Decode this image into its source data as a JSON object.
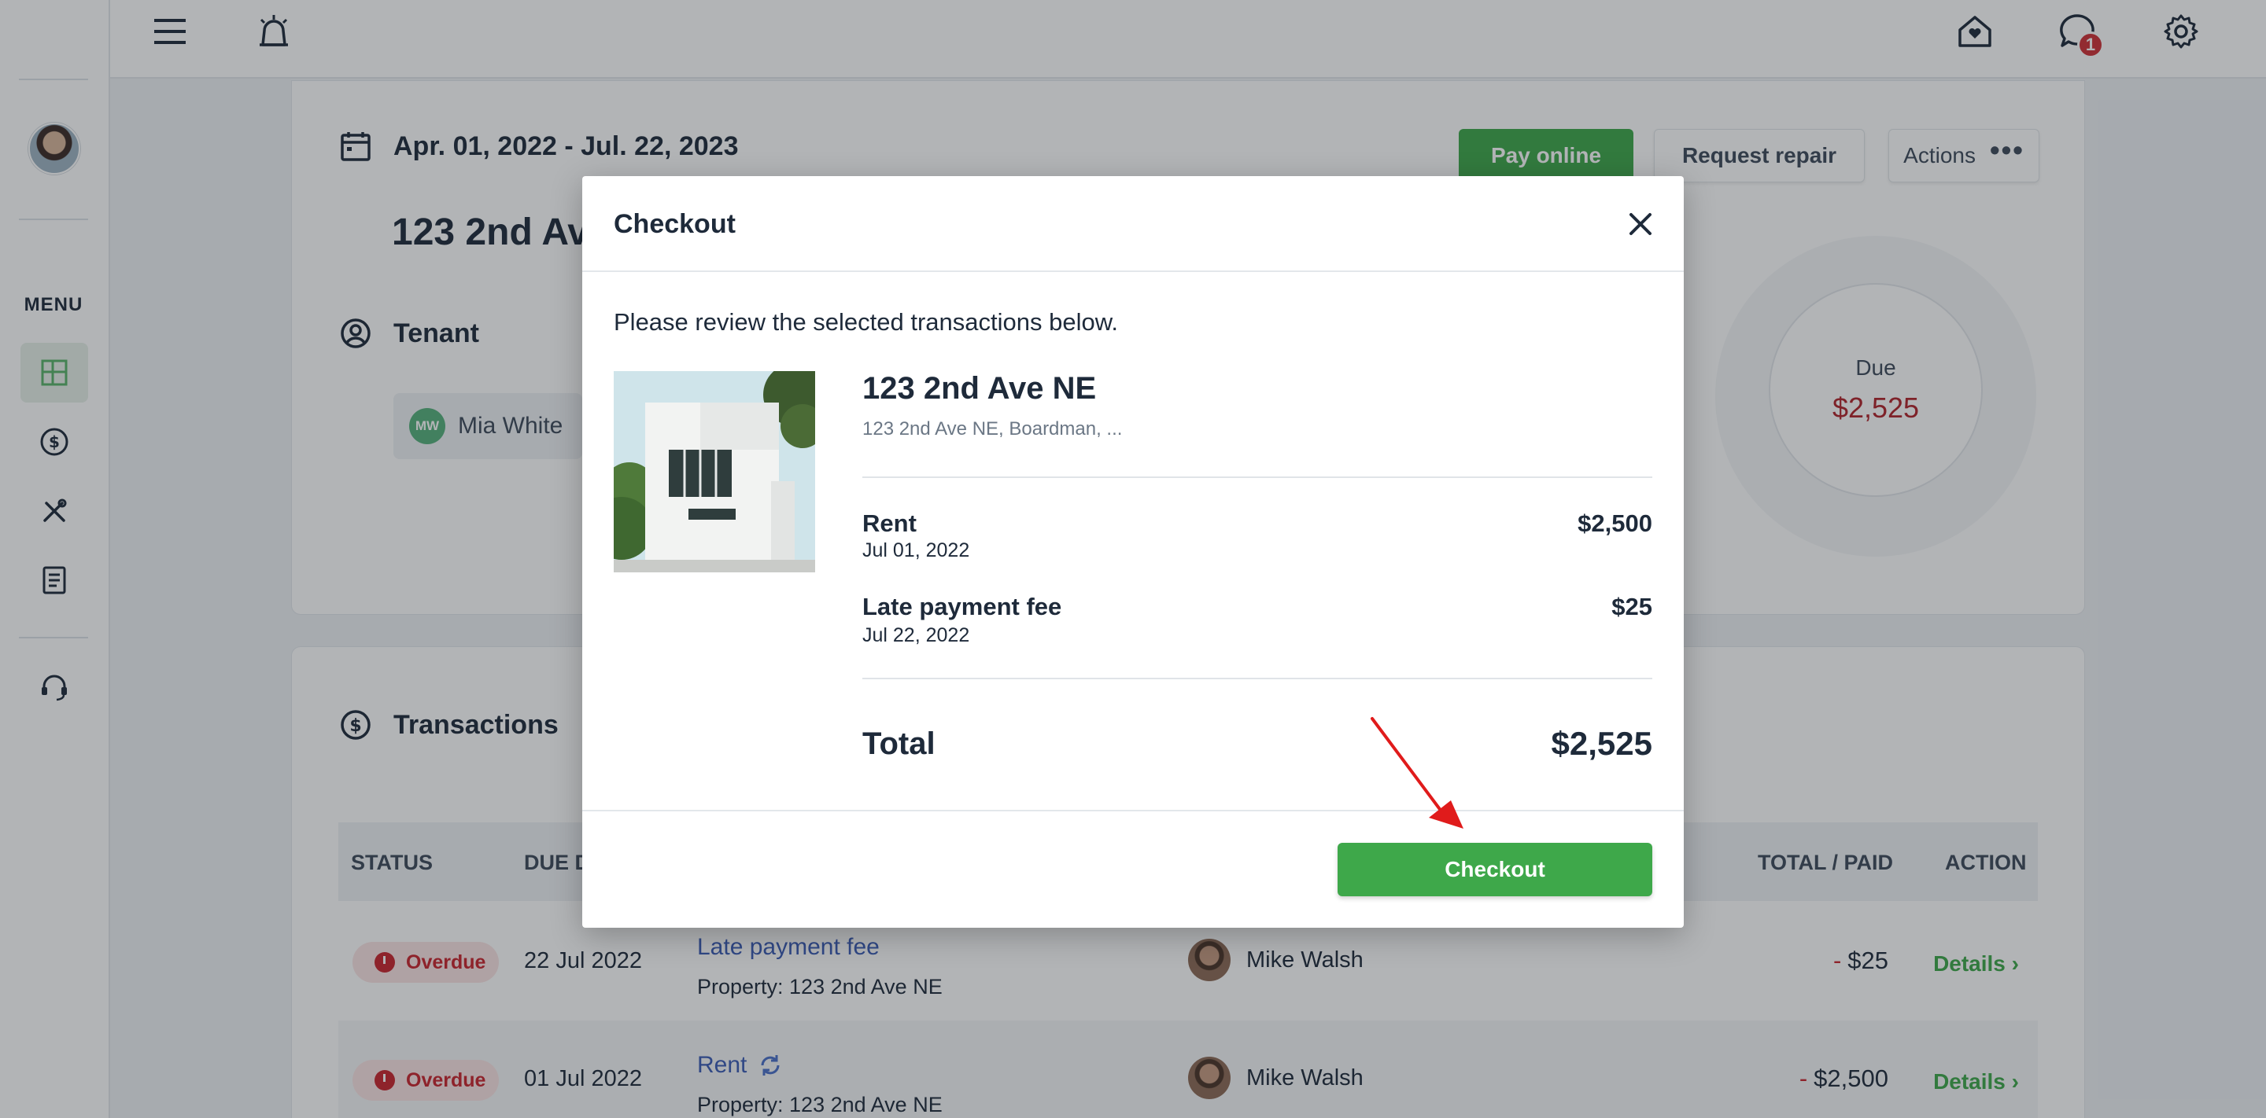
{
  "sidebar": {
    "menu_label": "MENU",
    "items": [
      {
        "icon": "dashboard-icon",
        "active": true
      },
      {
        "icon": "dollar-circle-icon"
      },
      {
        "icon": "tools-icon"
      },
      {
        "icon": "document-icon"
      },
      {
        "icon": "headset-icon"
      }
    ]
  },
  "topbar": {
    "left_icons": [
      "hamburger-menu-icon",
      "alarm-icon"
    ],
    "right_icons": [
      "home-heart-icon",
      "chat-icon",
      "gear-icon"
    ],
    "notification_count": "1"
  },
  "lease": {
    "date_range": "Apr. 01, 2022 - Jul. 22, 2023",
    "property_title": "123 2nd Av",
    "tenant_section_title": "Tenant",
    "tenant": {
      "initials": "MW",
      "name": "Mia White"
    },
    "buttons": {
      "pay_online": "Pay online",
      "request_repair": "Request repair",
      "actions": "Actions"
    },
    "due": {
      "label": "Due",
      "amount": "$2,525"
    }
  },
  "transactions": {
    "title": "Transactions",
    "columns": {
      "status": "STATUS",
      "due_date": "DUE D",
      "total_paid": "TOTAL / PAID",
      "action": "ACTION"
    },
    "rows": [
      {
        "status": "Overdue",
        "due_date": "22 Jul 2022",
        "type": "Late payment fee",
        "property": "Property: 123 2nd Ave NE",
        "person": "Mike Walsh",
        "minus": "-",
        "amount": "$25",
        "action": "Details ›"
      },
      {
        "status": "Overdue",
        "due_date": "01 Jul 2022",
        "type": "Rent",
        "property": "Property: 123 2nd Ave NE",
        "person": "Mike Walsh",
        "minus": "-",
        "amount": "$2,500",
        "action": "Details ›"
      }
    ]
  },
  "modal": {
    "title": "Checkout",
    "intro": "Please review the selected transactions below.",
    "property": {
      "name": "123 2nd Ave NE",
      "address": "123 2nd Ave NE, Boardman, ..."
    },
    "line_items": [
      {
        "name": "Rent",
        "date": "Jul 01, 2022",
        "amount": "$2,500"
      },
      {
        "name": "Late payment fee",
        "date": "Jul 22, 2022",
        "amount": "$25"
      }
    ],
    "total_label": "Total",
    "total_amount": "$2,525",
    "checkout_button": "Checkout"
  },
  "colors": {
    "brand_green": "#3ea84a",
    "overdue_red": "#c8232c",
    "annotation_arrow": "#e01b1b"
  }
}
